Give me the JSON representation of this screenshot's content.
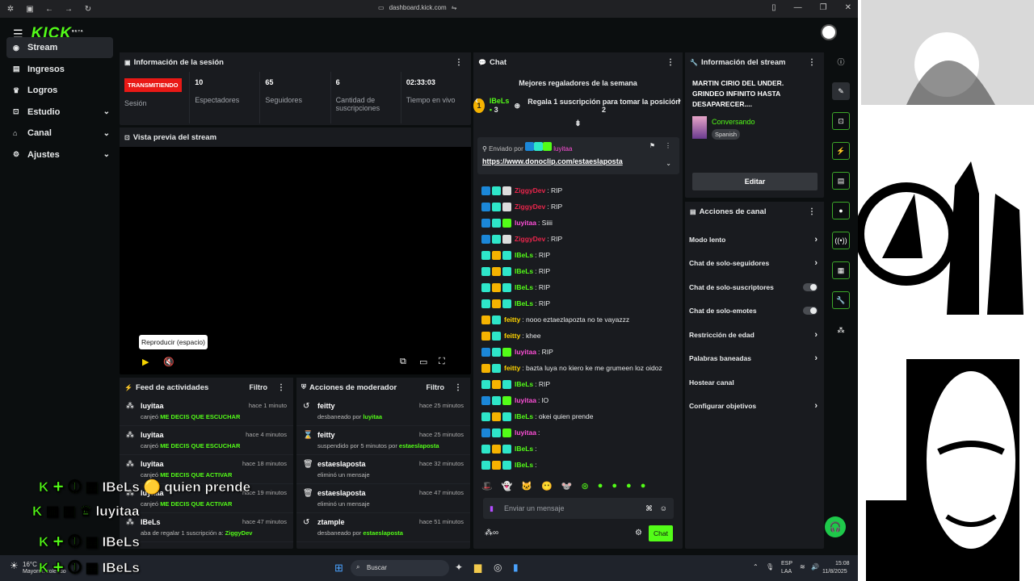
{
  "browser": {
    "url": "dashboard.kick.com"
  },
  "app": {
    "logo": "KICK",
    "logo_badge": "BETA"
  },
  "sidebar": {
    "items": [
      {
        "label": "Stream",
        "icon": "stream-icon"
      },
      {
        "label": "Ingresos",
        "icon": "money-icon"
      },
      {
        "label": "Logros",
        "icon": "trophy-icon"
      },
      {
        "label": "Estudio",
        "icon": "studio-icon"
      },
      {
        "label": "Canal",
        "icon": "channel-icon"
      },
      {
        "label": "Ajustes",
        "icon": "gear-icon"
      }
    ]
  },
  "session": {
    "title": "Información de la sesión",
    "status_badge": "TRANSMITIENDO",
    "status_label": "Sesión",
    "stats": [
      {
        "value": "10",
        "label": "Espectadores"
      },
      {
        "value": "65",
        "label": "Seguidores"
      },
      {
        "value": "6",
        "label": "Cantidad de suscripciones"
      },
      {
        "value": "02:33:03",
        "label": "Tiempo en vivo"
      }
    ]
  },
  "preview": {
    "title": "Vista previa del stream",
    "tooltip": "Reproducir (espacio)"
  },
  "feed": {
    "title": "Feed de actividades",
    "filter": "Filtro",
    "items": [
      {
        "user": "luyitaa",
        "pre": "canjeó ",
        "hl": "ME DECIS QUE ESCUCHAR",
        "time": "hace 1 minuto"
      },
      {
        "user": "luyitaa",
        "pre": "canjeó ",
        "hl": "ME DECIS QUE ESCUCHAR",
        "time": "hace 4 minutos"
      },
      {
        "user": "luyitaa",
        "pre": "canjeó ",
        "hl": "ME DECIS QUE ACTIVAR",
        "time": "hace 18 minutos"
      },
      {
        "user": "luyitaa",
        "pre": "canjeó ",
        "hl": "ME DECIS QUE ACTIVAR",
        "time": "hace 19 minutos"
      },
      {
        "user": "IBeLs",
        "pre": "aba de regalar 1 suscripción a: ",
        "hl": "ZiggyDev",
        "time": "hace 47 minutos"
      }
    ]
  },
  "mod": {
    "title": "Acciones de moderador",
    "filter": "Filtro",
    "items": [
      {
        "user": "feitty",
        "pre": "desbaneado por ",
        "hl": "luyitaa",
        "time": "hace 25 minutos",
        "icon": "unban-icon"
      },
      {
        "user": "feitty",
        "pre": "suspendido por 5 minutos por ",
        "hl": "estaeslaposta",
        "time": "hace 25 minutos",
        "icon": "hourglass-icon"
      },
      {
        "user": "estaeslaposta",
        "pre": "eliminó un mensaje",
        "hl": "",
        "time": "hace 32 minutos",
        "icon": "trash-icon"
      },
      {
        "user": "estaeslaposta",
        "pre": "eliminó un mensaje",
        "hl": "",
        "time": "hace 47 minutos",
        "icon": "trash-icon"
      },
      {
        "user": "ztample",
        "pre": "desbaneado por ",
        "hl": "estaeslaposta",
        "time": "hace 51 minutos",
        "icon": "unban-icon"
      }
    ]
  },
  "chat": {
    "title": "Chat",
    "gifters_title": "Mejores regaladores de la semana",
    "top_gifter": "IBeLs",
    "top_gifter_count": "3",
    "gift_cta": "Regala 1 suscripción para tomar la posición 2",
    "pinned_by_label": "Enviado por",
    "pinned_user": "luyitaa",
    "pinned_link": "https://www.donoclip.com/estaeslaposta",
    "messages": [
      {
        "user": "ZiggyDev",
        "color": "#e8254b",
        "text": ": RIP"
      },
      {
        "user": "ZiggyDev",
        "color": "#e8254b",
        "text": ": RIP"
      },
      {
        "user": "luyitaa",
        "color": "#ff4fd8",
        "text": ": Siiii"
      },
      {
        "user": "ZiggyDev",
        "color": "#e8254b",
        "text": ": RIP"
      },
      {
        "user": "IBeLs",
        "color": "#53fc18",
        "text": ": RIP"
      },
      {
        "user": "IBeLs",
        "color": "#53fc18",
        "text": ": RIP"
      },
      {
        "user": "IBeLs",
        "color": "#53fc18",
        "text": ": RIP"
      },
      {
        "user": "IBeLs",
        "color": "#53fc18",
        "text": ": RIP"
      },
      {
        "user": "feitty",
        "color": "#ffd400",
        "text": ": nooo eztaezlapozta no te vayazzz"
      },
      {
        "user": "feitty",
        "color": "#ffd400",
        "text": ": khee"
      },
      {
        "user": "luyitaa",
        "color": "#ff4fd8",
        "text": ": RIP"
      },
      {
        "user": "feitty",
        "color": "#ffd400",
        "text": ": bazta luya no kiero ke me grumeen loz oidoz"
      },
      {
        "user": "IBeLs",
        "color": "#53fc18",
        "text": ": RIP"
      },
      {
        "user": "luyitaa",
        "color": "#ff4fd8",
        "text": ": lO"
      },
      {
        "user": "IBeLs",
        "color": "#53fc18",
        "text": ": okei quien prende"
      },
      {
        "user": "luyitaa",
        "color": "#ff4fd8",
        "text": ":"
      },
      {
        "user": "IBeLs",
        "color": "#53fc18",
        "text": ":"
      },
      {
        "user": "IBeLs",
        "color": "#53fc18",
        "text": ":"
      }
    ],
    "input_placeholder": "Enviar un mensaje",
    "send_label": "Chat"
  },
  "stream_info": {
    "title": "Información del stream",
    "stream_title": "MARTIN CIRIO DEL UNDER. GRINDEO INFINITO HASTA DESAPARECER....",
    "category": "Conversando",
    "language": "Spanish",
    "edit_label": "Editar"
  },
  "channel_actions": {
    "title": "Acciones de canal",
    "items": [
      {
        "label": "Modo lento",
        "type": "chevron"
      },
      {
        "label": "Chat de solo-seguidores",
        "type": "chevron"
      },
      {
        "label": "Chat de solo-suscriptores",
        "type": "toggle"
      },
      {
        "label": "Chat de solo-emotes",
        "type": "toggle"
      },
      {
        "label": "Restricción de edad",
        "type": "chevron"
      },
      {
        "label": "Palabras baneadas",
        "type": "chevron"
      },
      {
        "label": "Hostear canal",
        "type": "none"
      },
      {
        "label": "Configurar objetivos",
        "type": "chevron"
      }
    ]
  },
  "overlay": {
    "line1_user": "IBeLs",
    "line1_msg": "quien prende",
    "line2_user": "luyitaa",
    "line3_user": "IBeLs",
    "line4_user": "IBeLs"
  },
  "taskbar": {
    "weather_temp": "16°C",
    "weather_desc": "Mayorm. soleado",
    "search": "Buscar",
    "lang": "ESP",
    "lang2": "LAA",
    "time": "15:08",
    "date": "11/8/2025"
  },
  "colors": {
    "accent": "#53fc18",
    "live": "#e91916",
    "panel": "#191b1f"
  }
}
